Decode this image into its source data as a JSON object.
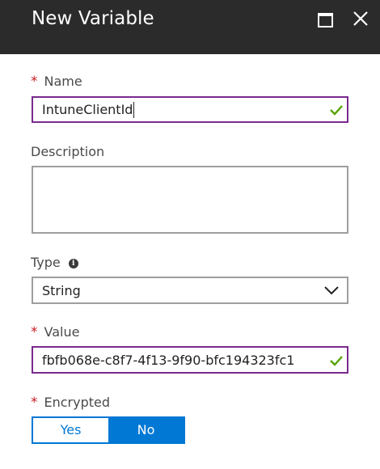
{
  "header": {
    "title": "New Variable",
    "maximize_icon": "maximize-icon",
    "close_icon": "close-icon"
  },
  "form": {
    "name": {
      "label": "Name",
      "required_mark": "*",
      "value": "IntuneClientId",
      "valid_icon": "checkmark-icon"
    },
    "description": {
      "label": "Description",
      "value": ""
    },
    "type": {
      "label": "Type",
      "info_icon": "info-icon",
      "selected": "String"
    },
    "value": {
      "label": "Value",
      "required_mark": "*",
      "value": "fbfb068e-c8f7-4f13-9f90-bfc194323fc1",
      "valid_icon": "checkmark-icon"
    },
    "encrypted": {
      "label": "Encrypted",
      "required_mark": "*",
      "options": [
        "Yes",
        "No"
      ],
      "selected": "No"
    }
  },
  "colors": {
    "header_bg": "#2b2b2b",
    "accent": "#0078d4",
    "active_border": "#7a2a8f",
    "required": "#c81f26",
    "valid": "#57a300"
  }
}
